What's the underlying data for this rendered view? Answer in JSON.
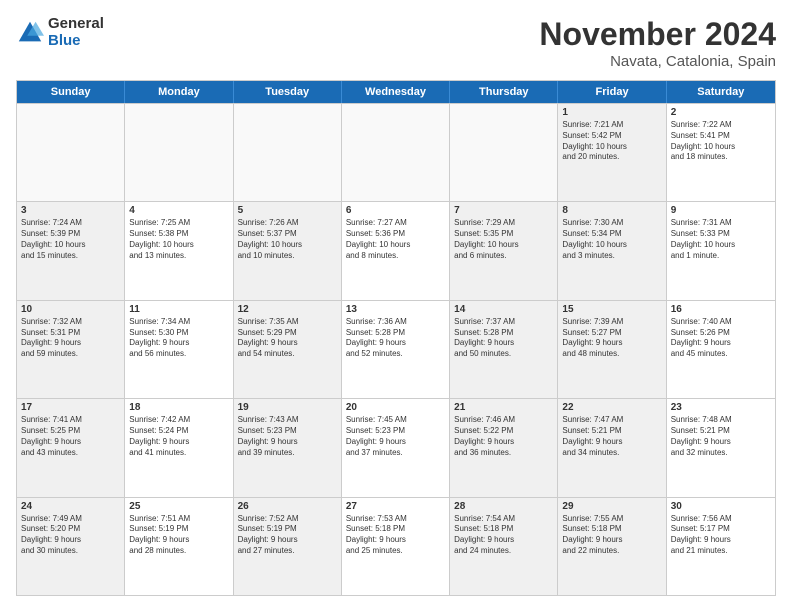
{
  "header": {
    "logo_general": "General",
    "logo_blue": "Blue",
    "month_title": "November 2024",
    "location": "Navata, Catalonia, Spain"
  },
  "weekdays": [
    "Sunday",
    "Monday",
    "Tuesday",
    "Wednesday",
    "Thursday",
    "Friday",
    "Saturday"
  ],
  "rows": [
    [
      {
        "day": "",
        "info": "",
        "empty": true
      },
      {
        "day": "",
        "info": "",
        "empty": true
      },
      {
        "day": "",
        "info": "",
        "empty": true
      },
      {
        "day": "",
        "info": "",
        "empty": true
      },
      {
        "day": "",
        "info": "",
        "empty": true
      },
      {
        "day": "1",
        "info": "Sunrise: 7:21 AM\nSunset: 5:42 PM\nDaylight: 10 hours\nand 20 minutes.",
        "shaded": true
      },
      {
        "day": "2",
        "info": "Sunrise: 7:22 AM\nSunset: 5:41 PM\nDaylight: 10 hours\nand 18 minutes."
      }
    ],
    [
      {
        "day": "3",
        "info": "Sunrise: 7:24 AM\nSunset: 5:39 PM\nDaylight: 10 hours\nand 15 minutes.",
        "shaded": true
      },
      {
        "day": "4",
        "info": "Sunrise: 7:25 AM\nSunset: 5:38 PM\nDaylight: 10 hours\nand 13 minutes."
      },
      {
        "day": "5",
        "info": "Sunrise: 7:26 AM\nSunset: 5:37 PM\nDaylight: 10 hours\nand 10 minutes.",
        "shaded": true
      },
      {
        "day": "6",
        "info": "Sunrise: 7:27 AM\nSunset: 5:36 PM\nDaylight: 10 hours\nand 8 minutes."
      },
      {
        "day": "7",
        "info": "Sunrise: 7:29 AM\nSunset: 5:35 PM\nDaylight: 10 hours\nand 6 minutes.",
        "shaded": true
      },
      {
        "day": "8",
        "info": "Sunrise: 7:30 AM\nSunset: 5:34 PM\nDaylight: 10 hours\nand 3 minutes.",
        "shaded": true
      },
      {
        "day": "9",
        "info": "Sunrise: 7:31 AM\nSunset: 5:33 PM\nDaylight: 10 hours\nand 1 minute."
      }
    ],
    [
      {
        "day": "10",
        "info": "Sunrise: 7:32 AM\nSunset: 5:31 PM\nDaylight: 9 hours\nand 59 minutes.",
        "shaded": true
      },
      {
        "day": "11",
        "info": "Sunrise: 7:34 AM\nSunset: 5:30 PM\nDaylight: 9 hours\nand 56 minutes."
      },
      {
        "day": "12",
        "info": "Sunrise: 7:35 AM\nSunset: 5:29 PM\nDaylight: 9 hours\nand 54 minutes.",
        "shaded": true
      },
      {
        "day": "13",
        "info": "Sunrise: 7:36 AM\nSunset: 5:28 PM\nDaylight: 9 hours\nand 52 minutes."
      },
      {
        "day": "14",
        "info": "Sunrise: 7:37 AM\nSunset: 5:28 PM\nDaylight: 9 hours\nand 50 minutes.",
        "shaded": true
      },
      {
        "day": "15",
        "info": "Sunrise: 7:39 AM\nSunset: 5:27 PM\nDaylight: 9 hours\nand 48 minutes.",
        "shaded": true
      },
      {
        "day": "16",
        "info": "Sunrise: 7:40 AM\nSunset: 5:26 PM\nDaylight: 9 hours\nand 45 minutes."
      }
    ],
    [
      {
        "day": "17",
        "info": "Sunrise: 7:41 AM\nSunset: 5:25 PM\nDaylight: 9 hours\nand 43 minutes.",
        "shaded": true
      },
      {
        "day": "18",
        "info": "Sunrise: 7:42 AM\nSunset: 5:24 PM\nDaylight: 9 hours\nand 41 minutes."
      },
      {
        "day": "19",
        "info": "Sunrise: 7:43 AM\nSunset: 5:23 PM\nDaylight: 9 hours\nand 39 minutes.",
        "shaded": true
      },
      {
        "day": "20",
        "info": "Sunrise: 7:45 AM\nSunset: 5:23 PM\nDaylight: 9 hours\nand 37 minutes."
      },
      {
        "day": "21",
        "info": "Sunrise: 7:46 AM\nSunset: 5:22 PM\nDaylight: 9 hours\nand 36 minutes.",
        "shaded": true
      },
      {
        "day": "22",
        "info": "Sunrise: 7:47 AM\nSunset: 5:21 PM\nDaylight: 9 hours\nand 34 minutes.",
        "shaded": true
      },
      {
        "day": "23",
        "info": "Sunrise: 7:48 AM\nSunset: 5:21 PM\nDaylight: 9 hours\nand 32 minutes."
      }
    ],
    [
      {
        "day": "24",
        "info": "Sunrise: 7:49 AM\nSunset: 5:20 PM\nDaylight: 9 hours\nand 30 minutes.",
        "shaded": true
      },
      {
        "day": "25",
        "info": "Sunrise: 7:51 AM\nSunset: 5:19 PM\nDaylight: 9 hours\nand 28 minutes."
      },
      {
        "day": "26",
        "info": "Sunrise: 7:52 AM\nSunset: 5:19 PM\nDaylight: 9 hours\nand 27 minutes.",
        "shaded": true
      },
      {
        "day": "27",
        "info": "Sunrise: 7:53 AM\nSunset: 5:18 PM\nDaylight: 9 hours\nand 25 minutes."
      },
      {
        "day": "28",
        "info": "Sunrise: 7:54 AM\nSunset: 5:18 PM\nDaylight: 9 hours\nand 24 minutes.",
        "shaded": true
      },
      {
        "day": "29",
        "info": "Sunrise: 7:55 AM\nSunset: 5:18 PM\nDaylight: 9 hours\nand 22 minutes.",
        "shaded": true
      },
      {
        "day": "30",
        "info": "Sunrise: 7:56 AM\nSunset: 5:17 PM\nDaylight: 9 hours\nand 21 minutes."
      }
    ]
  ]
}
